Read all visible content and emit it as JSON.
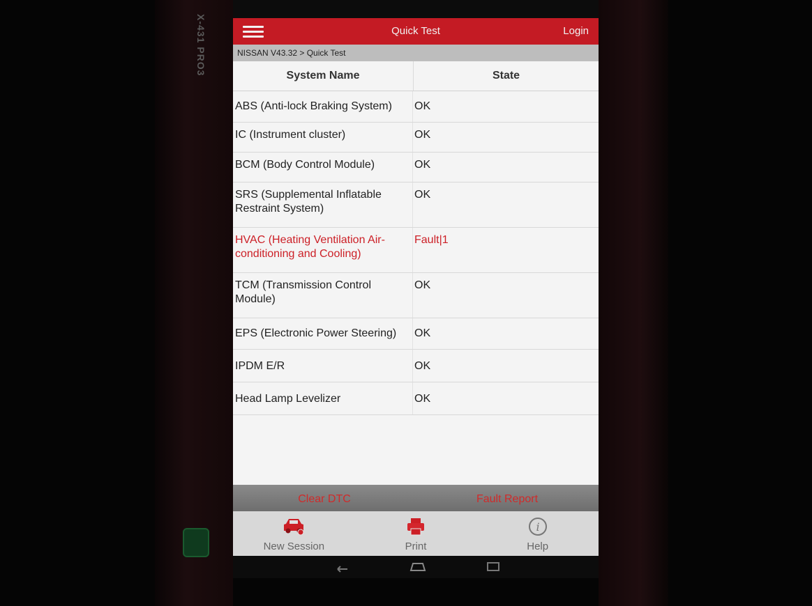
{
  "device": {
    "brand_label": "X-431 PRO3"
  },
  "header": {
    "title": "Quick Test",
    "login_label": "Login"
  },
  "breadcrumb": "NISSAN V43.32 > Quick Test",
  "table": {
    "columns": [
      "System Name",
      "State"
    ],
    "rows": [
      {
        "name": "ABS (Anti-lock Braking System)",
        "state": "OK",
        "fault": false
      },
      {
        "name": "IC (Instrument cluster)",
        "state": "OK",
        "fault": false
      },
      {
        "name": "BCM (Body Control Module)",
        "state": "OK",
        "fault": false
      },
      {
        "name": "SRS (Supplemental Inflatable Restraint System)",
        "state": "OK",
        "fault": false
      },
      {
        "name": "HVAC (Heating Ventilation Air-conditioning and Cooling)",
        "state": "Fault|1",
        "fault": true
      },
      {
        "name": "TCM (Transmission Control Module)",
        "state": "OK",
        "fault": false
      },
      {
        "name": "EPS (Electronic Power Steering)",
        "state": "OK",
        "fault": false
      },
      {
        "name": "IPDM E/R",
        "state": "OK",
        "fault": false
      },
      {
        "name": "Head Lamp Levelizer",
        "state": "OK",
        "fault": false
      }
    ]
  },
  "actions": {
    "clear_dtc": "Clear DTC",
    "fault_report": "Fault Report"
  },
  "bottom_nav": [
    {
      "label": "New Session",
      "icon": "car-icon"
    },
    {
      "label": "Print",
      "icon": "printer-icon"
    },
    {
      "label": "Help",
      "icon": "info-icon"
    }
  ],
  "colors": {
    "accent": "#c41b24",
    "fault_text": "#cc1f26"
  }
}
